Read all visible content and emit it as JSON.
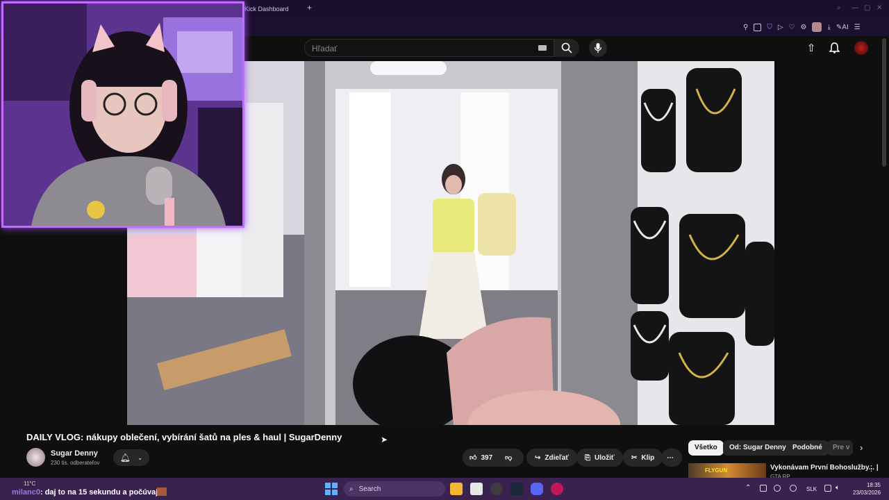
{
  "browser": {
    "tab_title": "Kick Dashboard",
    "new_tab_label": "+",
    "ai_label": "AI"
  },
  "youtube": {
    "search_placeholder": "Hľadať",
    "video_title": "DAILY VLOG: nákupy oblečení, vybírání šatů na ples & haul | SugarDenny",
    "channel_name": "Sugar Denny",
    "subscribers": "230 tis. odberateľov",
    "likes": "397",
    "share_label": "Zdieľať",
    "save_label": "Uložiť",
    "clip_label": "Klip",
    "more_label": "⋯",
    "chips": [
      "Všetko",
      "Od: Sugar Denny",
      "Podobné",
      "Pre v"
    ],
    "recommended": {
      "title": "Vykonávam První Bohoslužby... |",
      "subtitle": "GTA RP",
      "thumb_text": "FLYGUN"
    }
  },
  "stream_overlay": {
    "chat_user": "milanc0",
    "chat_message": ": daj to na 15 sekundu a počúvaj"
  },
  "taskbar": {
    "weather": "11°C",
    "search_label": "Search",
    "language": "SLK",
    "time": "18:35",
    "date": "23/03/2026"
  },
  "colors": {
    "webcam_border": "#c46cff",
    "taskbar": "#3a2250",
    "browser_chrome": "#1c1030"
  }
}
